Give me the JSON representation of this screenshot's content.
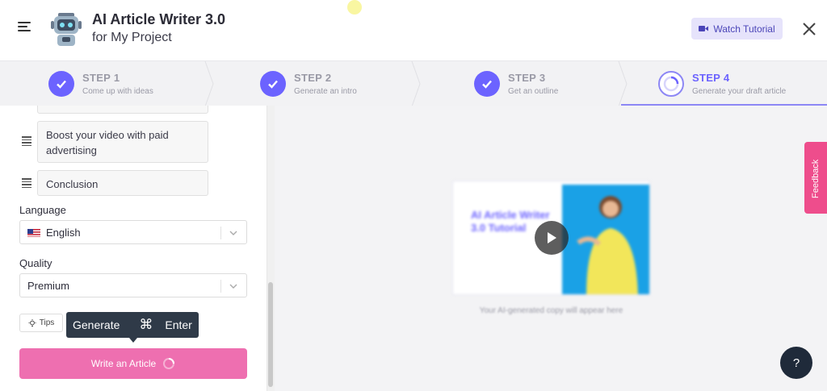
{
  "header": {
    "title": "AI Article Writer 3.0",
    "subtitle": "for My Project",
    "watch_tutorial": "Watch Tutorial",
    "accent": "#6c63ff"
  },
  "steps": [
    {
      "label": "STEP 1",
      "desc": "Come up with ideas",
      "state": "done"
    },
    {
      "label": "STEP 2",
      "desc": "Generate an intro",
      "state": "done"
    },
    {
      "label": "STEP 3",
      "desc": "Get an outline",
      "state": "done"
    },
    {
      "label": "STEP 4",
      "desc": "Generate your draft article",
      "state": "active"
    }
  ],
  "outline": {
    "items": [
      {
        "text": "Boost your video with paid advertising"
      },
      {
        "text": "Conclusion"
      }
    ]
  },
  "form": {
    "language_label": "Language",
    "language_value": "English",
    "quality_label": "Quality",
    "quality_value": "Premium",
    "tips": "Tips",
    "tooltip_action": "Generate",
    "tooltip_key": "⌘",
    "tooltip_enter": "Enter",
    "write_button": "Write an Article",
    "button_color": "#ee6fb0"
  },
  "preview": {
    "video_title": "AI Article Writer 3.0 Tutorial",
    "caption": "Your AI-generated copy will appear here"
  },
  "feedback": "Feedback",
  "help": "?"
}
